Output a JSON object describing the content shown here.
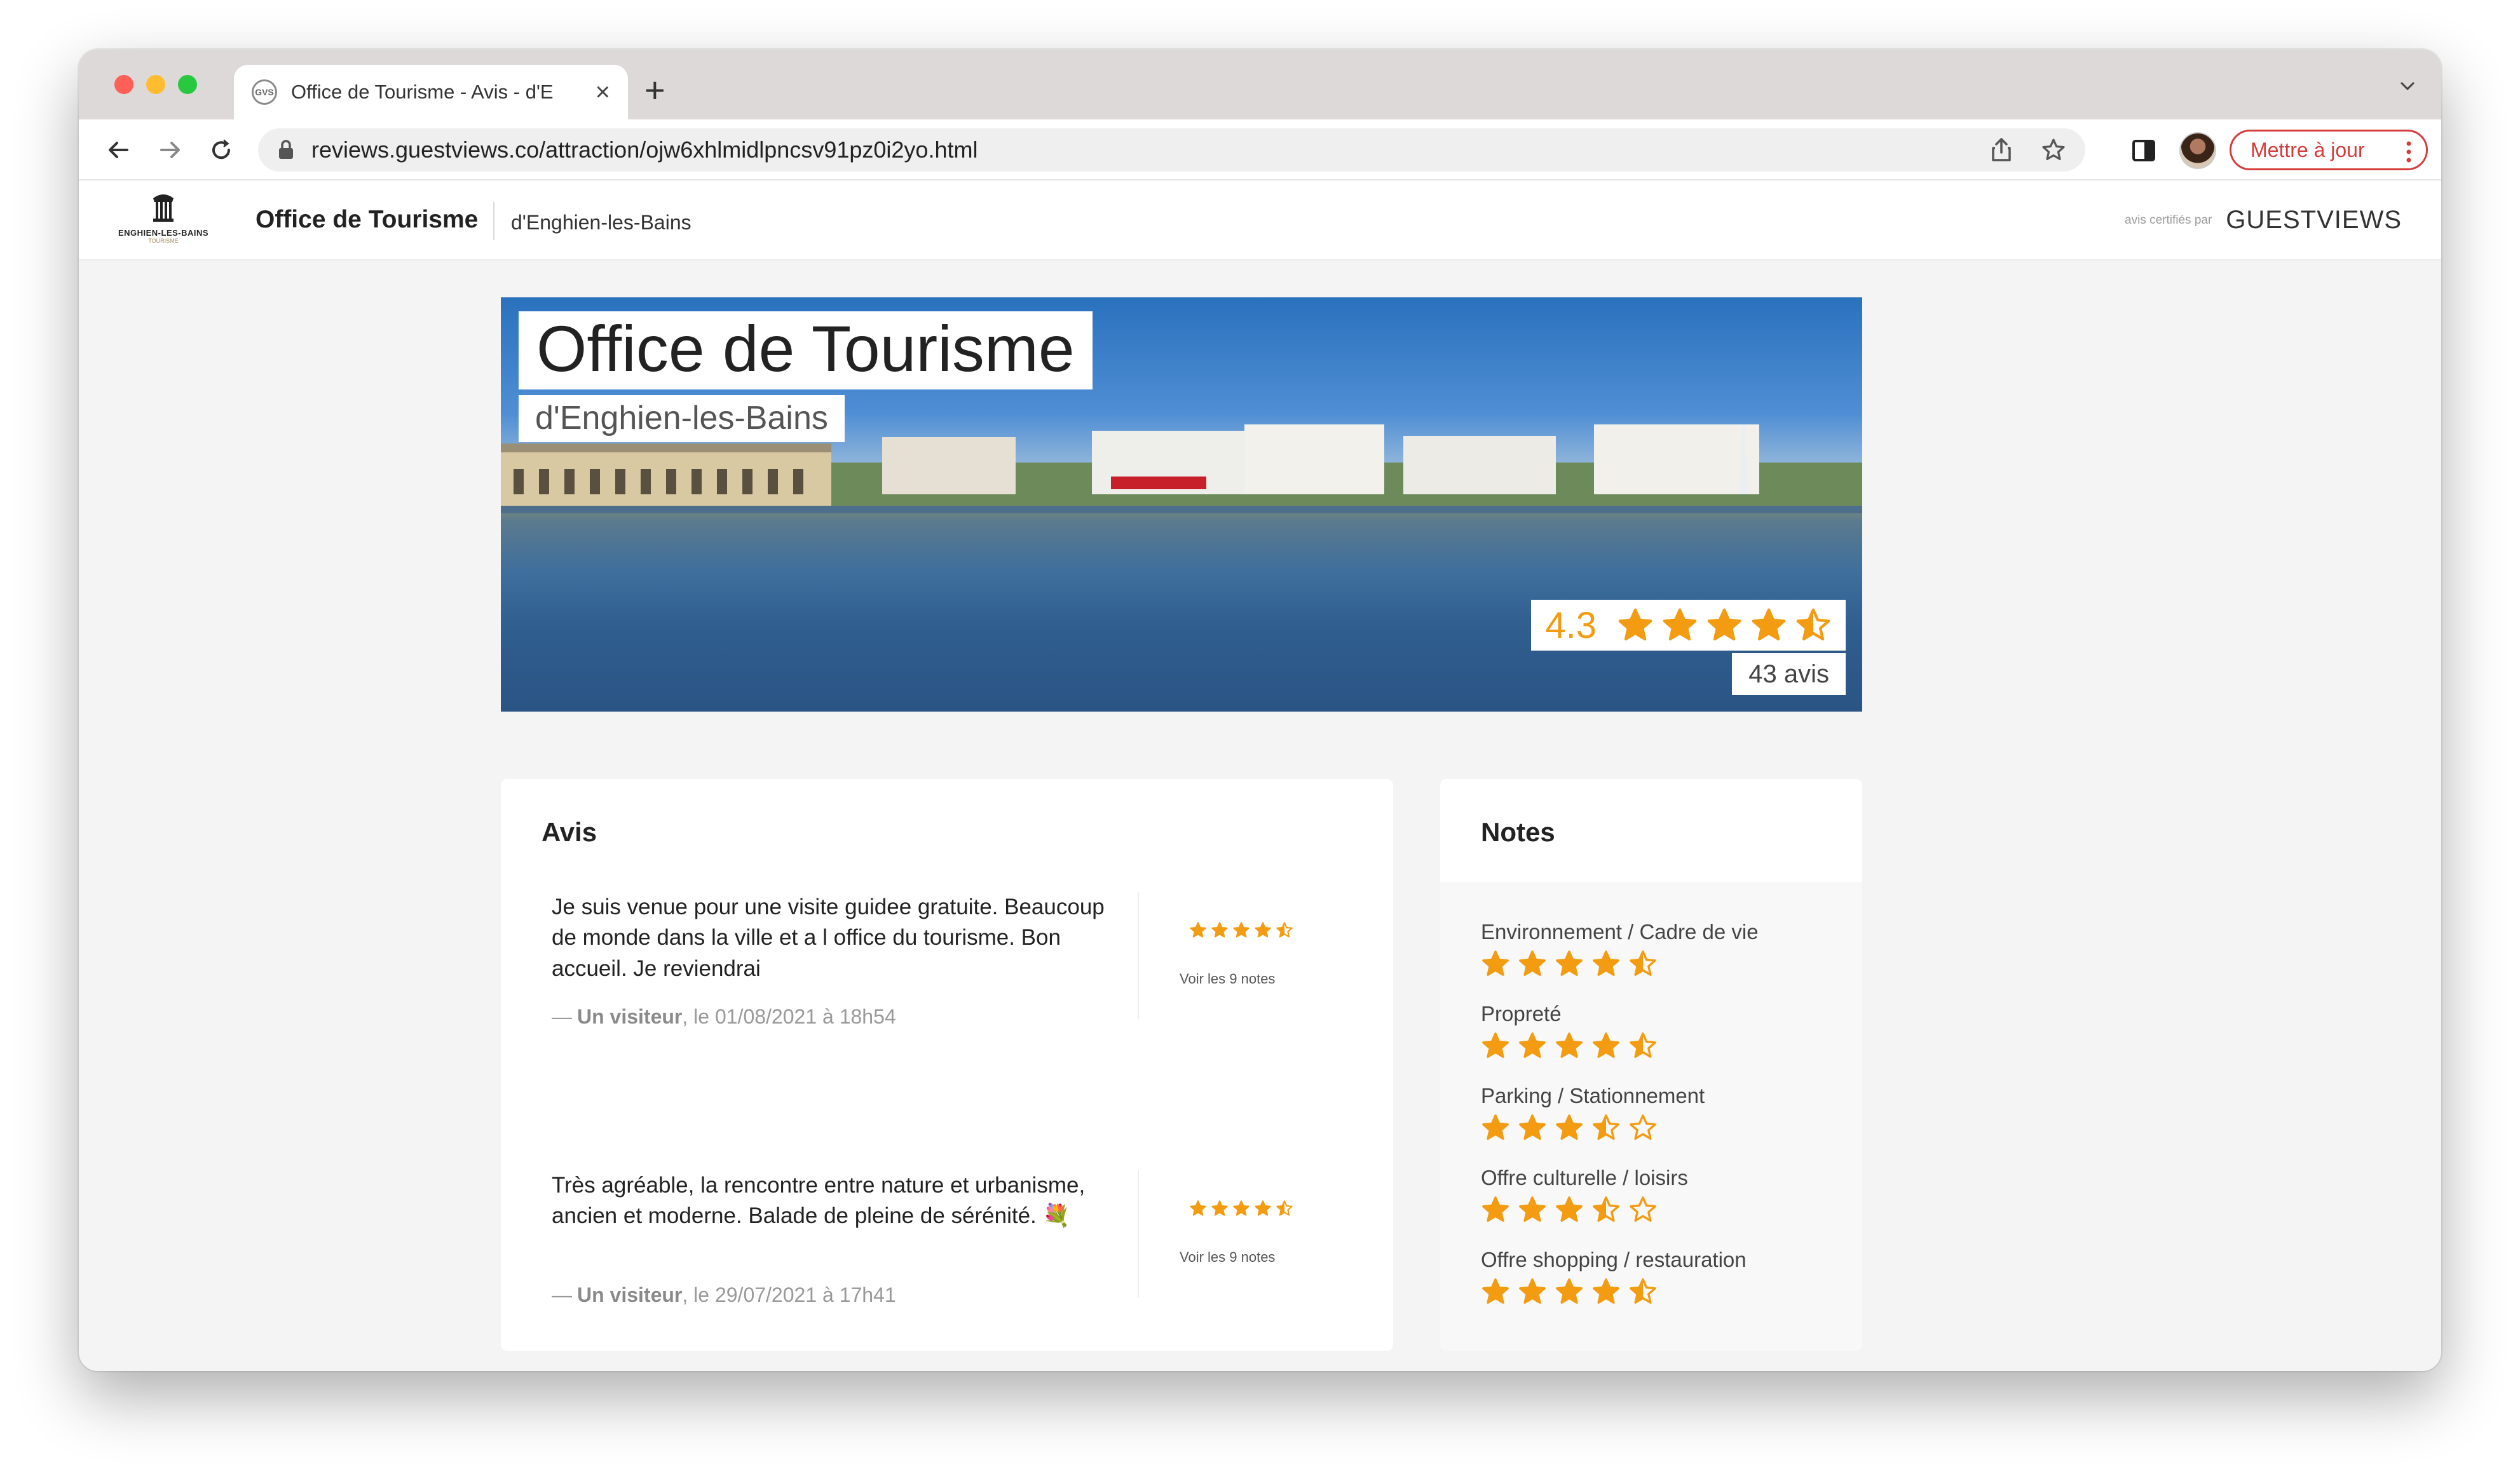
{
  "browser": {
    "tab_title": "Office de Tourisme - Avis - d'E",
    "tab_favicon_text": "GVS",
    "url": "reviews.guestviews.co/attraction/ojw6xhlmidlpncsv91pz0i2yo.html",
    "update_button": "Mettre à jour",
    "icons": [
      "back-arrow-icon",
      "forward-arrow-icon",
      "reload-icon",
      "lock-icon",
      "share-icon",
      "bookmark-star-icon",
      "sidepanel-icon",
      "profile-avatar",
      "kebab-menu-icon"
    ]
  },
  "site": {
    "logo_text": "ENGHIEN-LES-BAINS",
    "logo_sub": "TOURISME",
    "title": "Office de Tourisme",
    "subtitle": "d'Enghien-les-Bains",
    "certified_label": "avis certifiés par",
    "certified_brand": "GUESTVIEWS"
  },
  "hero": {
    "title": "Office de Tourisme",
    "subtitle": "d'Enghien-les-Bains",
    "rating_value": "4.3",
    "rating_stars": 4.5,
    "review_count": "43 avis",
    "star_color": "#f39c12"
  },
  "avis": {
    "title": "Avis",
    "reviews": [
      {
        "text": "Je suis venue pour une visite guidee gratuite. Beaucoup de monde dans la ville et a l office du tourisme. Bon accueil. Je reviendrai",
        "author": "Un visiteur",
        "date": ", le 01/08/2021 à 18h54",
        "stars": 4.5,
        "link": "Voir les 9 notes"
      },
      {
        "text": "Très agréable, la rencontre entre nature et urbanisme, ancien et moderne. Balade de pleine de sérénité. 💐",
        "author": "Un visiteur",
        "date": ", le 29/07/2021 à 17h41",
        "stars": 4.5,
        "link": "Voir les 9 notes"
      }
    ]
  },
  "notes": {
    "title": "Notes",
    "items": [
      {
        "label": "Environnement / Cadre de vie",
        "stars": 4.5
      },
      {
        "label": "Propreté",
        "stars": 4.5
      },
      {
        "label": "Parking / Stationnement",
        "stars": 3.5
      },
      {
        "label": "Offre culturelle / loisirs",
        "stars": 3.5
      },
      {
        "label": "Offre shopping / restauration",
        "stars": 4.5
      }
    ]
  }
}
